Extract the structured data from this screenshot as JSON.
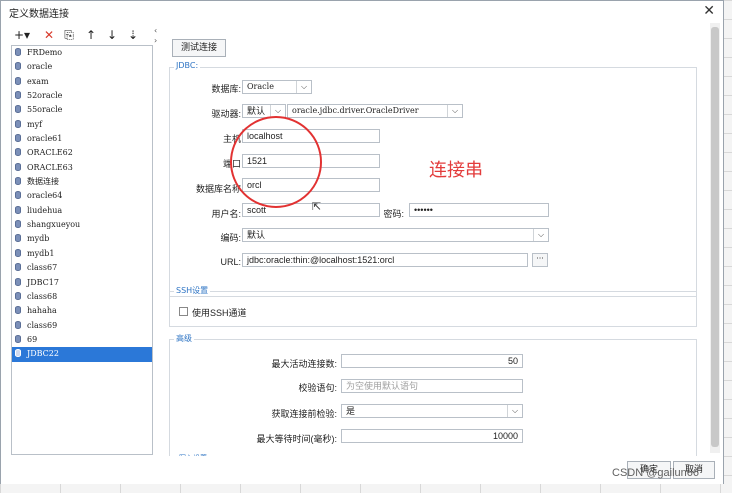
{
  "window": {
    "title": "定义数据连接",
    "close_glyph": "✕"
  },
  "toolbar": {
    "add": "+▾",
    "delete": "✕",
    "copy": "⎘",
    "up": "↑",
    "down": "↓",
    "sort": "⇣"
  },
  "connections": [
    "FRDemo",
    "oracle",
    "exam",
    "52oracle",
    "55oracle",
    "myf",
    "oracle61",
    "ORACLE62",
    "ORACLE63",
    "数据连接",
    "oracle64",
    "liudehua",
    "shangxueyou",
    "mydb",
    "mydb1",
    "class67",
    "JDBC17",
    "class68",
    "hahaha",
    "class69",
    "69",
    "JDBC22"
  ],
  "selected_connection": "JDBC22",
  "test_button": "测试连接",
  "jdbc": {
    "section_title": "JDBC:",
    "database_label": "数据库:",
    "database_value": "Oracle",
    "driver_label": "驱动器:",
    "driver_mode": "默认",
    "driver_class": "oracle.jdbc.driver.OracleDriver",
    "host_label": "主机",
    "host_value": "localhost",
    "port_label": "端口",
    "port_value": "1521",
    "dbname_label": "数据库名称",
    "dbname_value": "orcl",
    "user_label": "用户名:",
    "user_value": "scott",
    "password_label": "密码:",
    "password_value": "••••••",
    "encoding_label": "编码:",
    "encoding_value": "默认",
    "url_label": "URL:",
    "url_value": "jdbc:oracle:thin:@localhost:1521:orcl",
    "url_button": "···"
  },
  "ssh": {
    "section_title": "SSH设置",
    "checkbox_label": "使用SSH通道"
  },
  "advanced": {
    "section_title": "高级",
    "max_active_label": "最大活动连接数:",
    "max_active_value": "50",
    "validation_label": "校验语句:",
    "validation_placeholder": "为空使用默认语句",
    "test_before_label": "获取连接前检验:",
    "test_before_value": "是",
    "max_wait_label": "最大等待时间(毫秒):",
    "max_wait_value": "10000"
  },
  "cut_section_title": "写入设置",
  "annotation": {
    "text": "连接串",
    "color": "#e23232"
  },
  "footer": {
    "ok": "确定",
    "cancel": "取消"
  },
  "watermark": "CSDN @gailun66",
  "colors": {
    "accent": "#2b78d8",
    "section_title": "#2e74c4"
  }
}
